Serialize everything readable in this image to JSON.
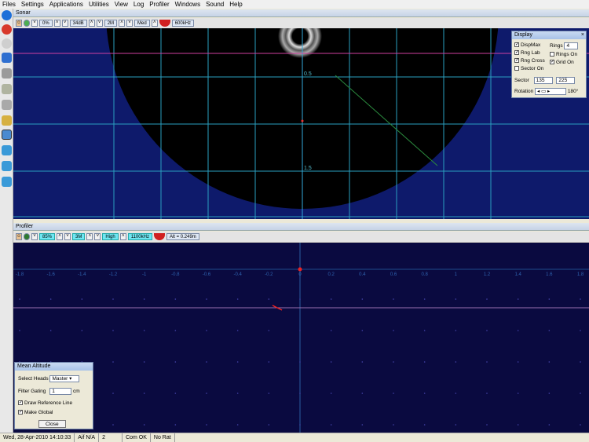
{
  "menu": [
    "Files",
    "Settings",
    "Applications",
    "Utilities",
    "View",
    "Log",
    "Profiler",
    "Windows",
    "Sound",
    "Help"
  ],
  "sonar": {
    "panel_title": "Sonar",
    "toolbar": [
      "0%",
      "34dB",
      "2M",
      "Med",
      "600kHz"
    ],
    "ring_labels": [
      "0.5",
      "1.5"
    ]
  },
  "profiler": {
    "panel_title": "Profiler",
    "toolbar": [
      "85%",
      "3M",
      "High",
      "1100kHz"
    ],
    "altitude": "Alt = 0.249m",
    "scale_labels": [
      "-1.8",
      "-1.6",
      "-1.4",
      "-1.2",
      "-1",
      "-0.8",
      "-0.6",
      "-0.4",
      "-0.2",
      "0",
      "0.2",
      "0.4",
      "0.6",
      "0.8",
      "1",
      "1.2",
      "1.4",
      "1.6",
      "1.8"
    ]
  },
  "display_dialog": {
    "title": "Display",
    "dispmax": "DispMax",
    "rng_lab": "Rng Lab",
    "rng_cross": "Rng Cross",
    "sector_on": "Sector On",
    "rings_label": "Rings",
    "rings_value": "4",
    "rings_on": "Rings On",
    "grid_on": "Grid On",
    "sector_label": "Sector",
    "sector_from": "135",
    "sector_to": "225",
    "rotation_label": "Rotation",
    "rotation_value": "180°"
  },
  "altitude_dialog": {
    "title": "Mean Altitude",
    "select_heads_label": "Select Heads",
    "select_heads_value": "Master",
    "filter_label": "Filter Gating",
    "filter_value": "1",
    "filter_unit": "cm",
    "draw_ref": "Draw Reference Line",
    "make_global": "Make Global",
    "close": "Close"
  },
  "status": [
    "Wed, 28-Apr-2010 14:10:33",
    "Aif N/A",
    "2",
    "Com OK",
    "No Rat"
  ]
}
